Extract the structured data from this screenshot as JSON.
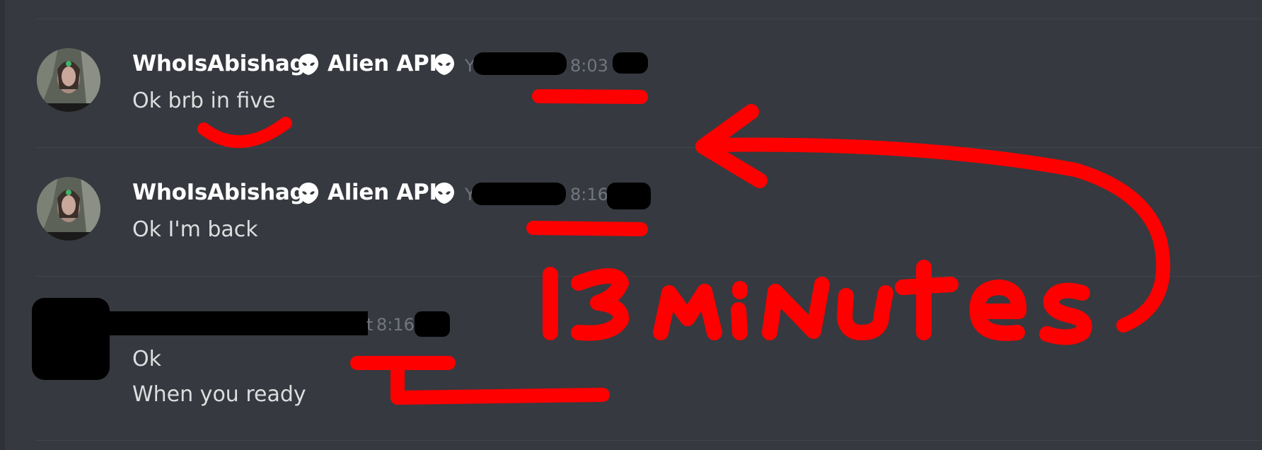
{
  "colors": {
    "background": "#36393f",
    "username": "#ffffff",
    "message_text": "#dcddde",
    "timestamp": "#72767d",
    "annotation_red": "#ff0000",
    "redaction": "#000000"
  },
  "messages": [
    {
      "username": "WhoIsAbishag",
      "bot_name": "Alien API",
      "badge_icon": "alien-icon",
      "timestamp_fragment": "Y",
      "time": "8:03",
      "lines": [
        "Ok brb in five"
      ]
    },
    {
      "username": "WhoIsAbishag",
      "bot_name": "Alien API",
      "badge_icon": "alien-icon",
      "timestamp_fragment": "Y",
      "time": "8:16",
      "lines": [
        "Ok I'm back"
      ]
    },
    {
      "timestamp_fragment": "t",
      "time": "8:16",
      "lines": [
        "Ok",
        "When you ready"
      ]
    }
  ],
  "annotation": {
    "label": "13 minutes"
  }
}
